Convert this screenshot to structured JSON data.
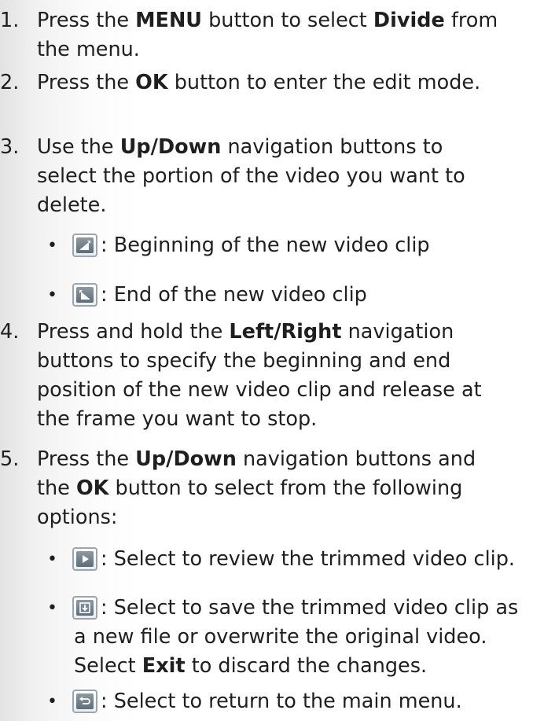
{
  "steps": [
    {
      "num": "1.",
      "parts": [
        "Press the ",
        "MENU",
        " button to select ",
        "Divide",
        " from",
        "the menu."
      ]
    },
    {
      "num": "2.",
      "parts": [
        "Press the ",
        "OK",
        " button to enter the edit mode."
      ]
    },
    {
      "num": "3.",
      "parts": [
        "Use the ",
        "Up/Down",
        " navigation buttons to",
        "select the portion of the video you want to",
        "delete."
      ],
      "bullets": [
        {
          "icon": "begin-clip-icon",
          "text": ": Beginning of the new video clip"
        },
        {
          "icon": "end-clip-icon",
          "text": ": End of the new video clip"
        }
      ]
    },
    {
      "num": "4.",
      "parts": [
        "Press and hold the ",
        "Left/Right",
        " navigation",
        "buttons to specify the beginning and end",
        "position of the new video clip and release at",
        "the frame you want to stop."
      ]
    },
    {
      "num": "5.",
      "parts": [
        "Press the ",
        "Up/Down",
        " navigation buttons and",
        "the ",
        "OK",
        " button to select from the following",
        "options:"
      ],
      "bullets": [
        {
          "icon": "play-icon",
          "text": ": Select to review the trimmed video clip."
        },
        {
          "icon": "save-icon",
          "lines": [
            ": Select to save the trimmed video clip as",
            "a new file or overwrite the original video.",
            "Select ",
            "Exit",
            " to discard the changes."
          ]
        },
        {
          "icon": "return-icon",
          "text": ": Select to return to the main menu."
        }
      ]
    }
  ],
  "bullet_char": "•"
}
